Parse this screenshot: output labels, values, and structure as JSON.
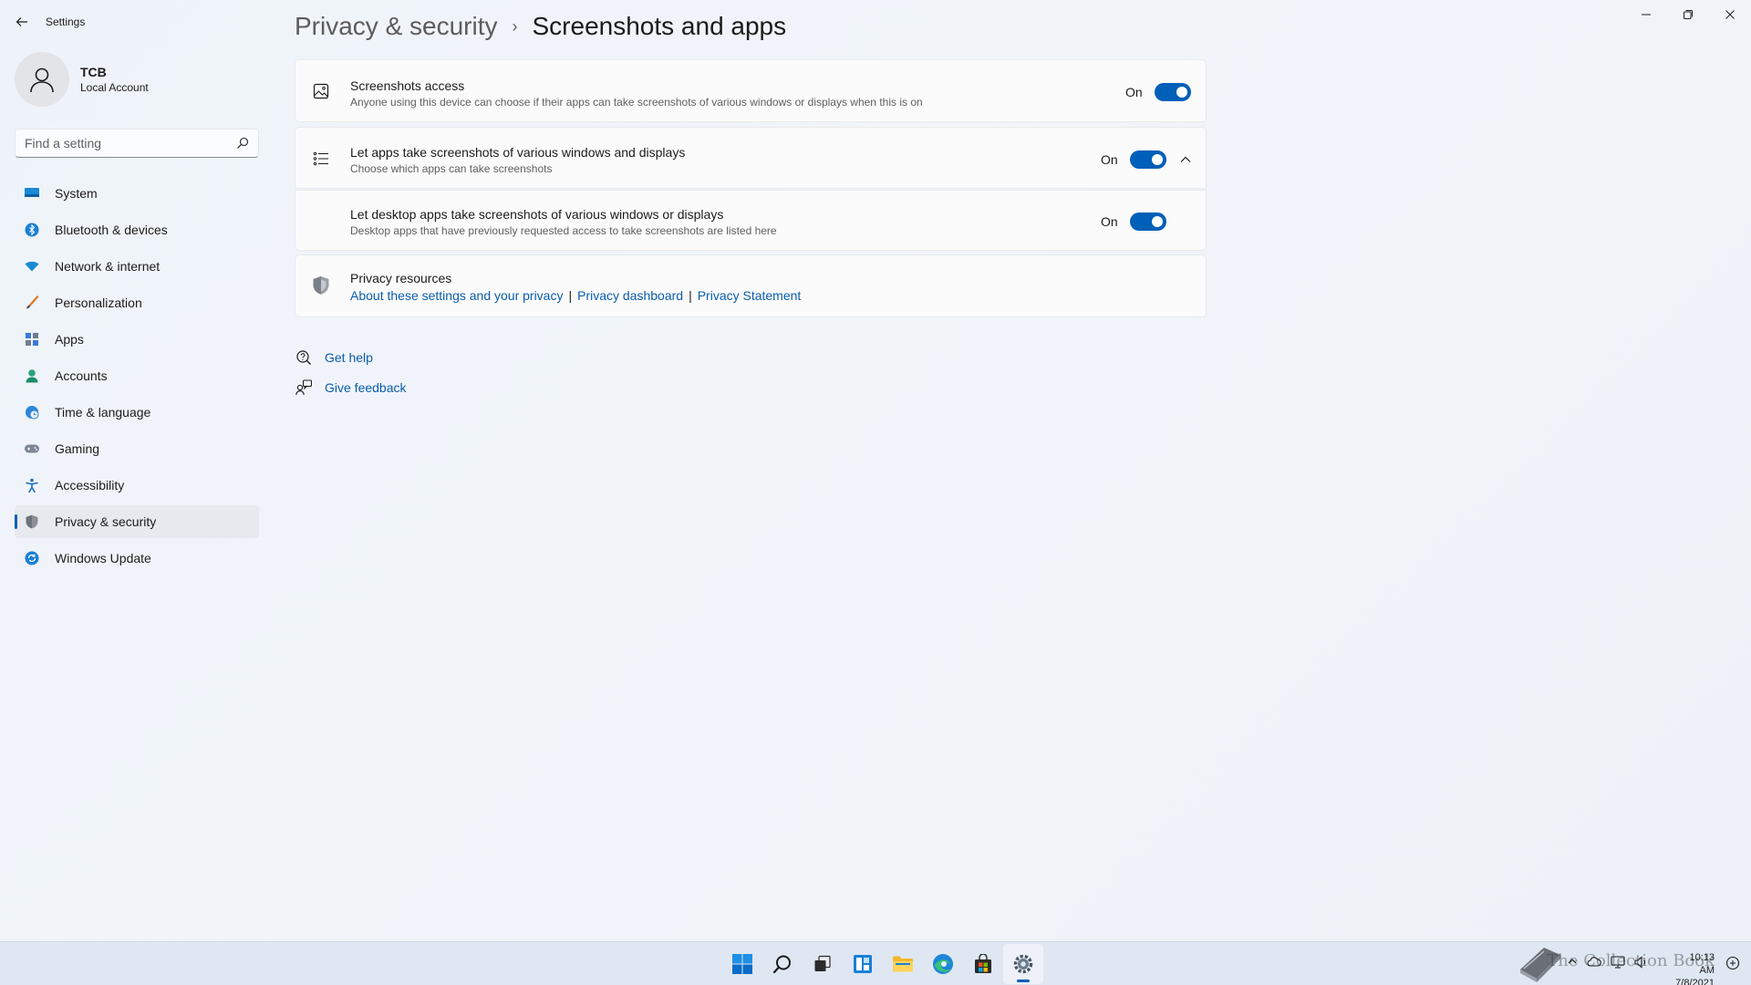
{
  "window": {
    "app_title": "Settings"
  },
  "profile": {
    "name": "TCB",
    "account_type": "Local Account"
  },
  "search": {
    "placeholder": "Find a setting"
  },
  "nav": {
    "items": [
      {
        "label": "System",
        "icon": "monitor-icon"
      },
      {
        "label": "Bluetooth & devices",
        "icon": "bluetooth-icon"
      },
      {
        "label": "Network & internet",
        "icon": "wifi-icon"
      },
      {
        "label": "Personalization",
        "icon": "brush-icon"
      },
      {
        "label": "Apps",
        "icon": "apps-icon"
      },
      {
        "label": "Accounts",
        "icon": "person-icon"
      },
      {
        "label": "Time & language",
        "icon": "globe-clock-icon"
      },
      {
        "label": "Gaming",
        "icon": "gamepad-icon"
      },
      {
        "label": "Accessibility",
        "icon": "accessibility-icon"
      },
      {
        "label": "Privacy & security",
        "icon": "shield-icon",
        "active": true
      },
      {
        "label": "Windows Update",
        "icon": "update-icon"
      }
    ]
  },
  "breadcrumb": {
    "parent": "Privacy & security",
    "separator": "›",
    "current": "Screenshots and apps"
  },
  "settings": {
    "screenshots_access": {
      "title": "Screenshots access",
      "description": "Anyone using this device can choose if their apps can take screenshots of various windows or displays when this is on",
      "state": "On",
      "icon": "image-icon"
    },
    "let_apps": {
      "title": "Let apps take screenshots of various windows and displays",
      "description": "Choose which apps can take screenshots",
      "state": "On",
      "icon": "list-icon",
      "expanded": true
    },
    "let_desktop_apps": {
      "title": "Let desktop apps take screenshots of various windows or displays",
      "description": "Desktop apps that have previously requested access to take screenshots are listed here",
      "state": "On"
    },
    "privacy_resources": {
      "title": "Privacy resources",
      "links": [
        "About these settings and your privacy",
        "Privacy dashboard",
        "Privacy Statement"
      ],
      "separator": "|",
      "icon": "shield-icon"
    }
  },
  "help": {
    "get_help": "Get help",
    "give_feedback": "Give feedback"
  },
  "taskbar": {
    "apps": [
      "windows-start-icon",
      "search-icon",
      "task-view-icon",
      "widgets-icon",
      "file-explorer-icon",
      "edge-icon",
      "store-icon",
      "settings-icon"
    ],
    "clock_time": "10:13 AM",
    "clock_date": "7/8/2021",
    "watermark": "The Collection Book"
  },
  "colors": {
    "accent": "#005fb8",
    "link": "#0a5cab",
    "background": "#eef3f9"
  }
}
